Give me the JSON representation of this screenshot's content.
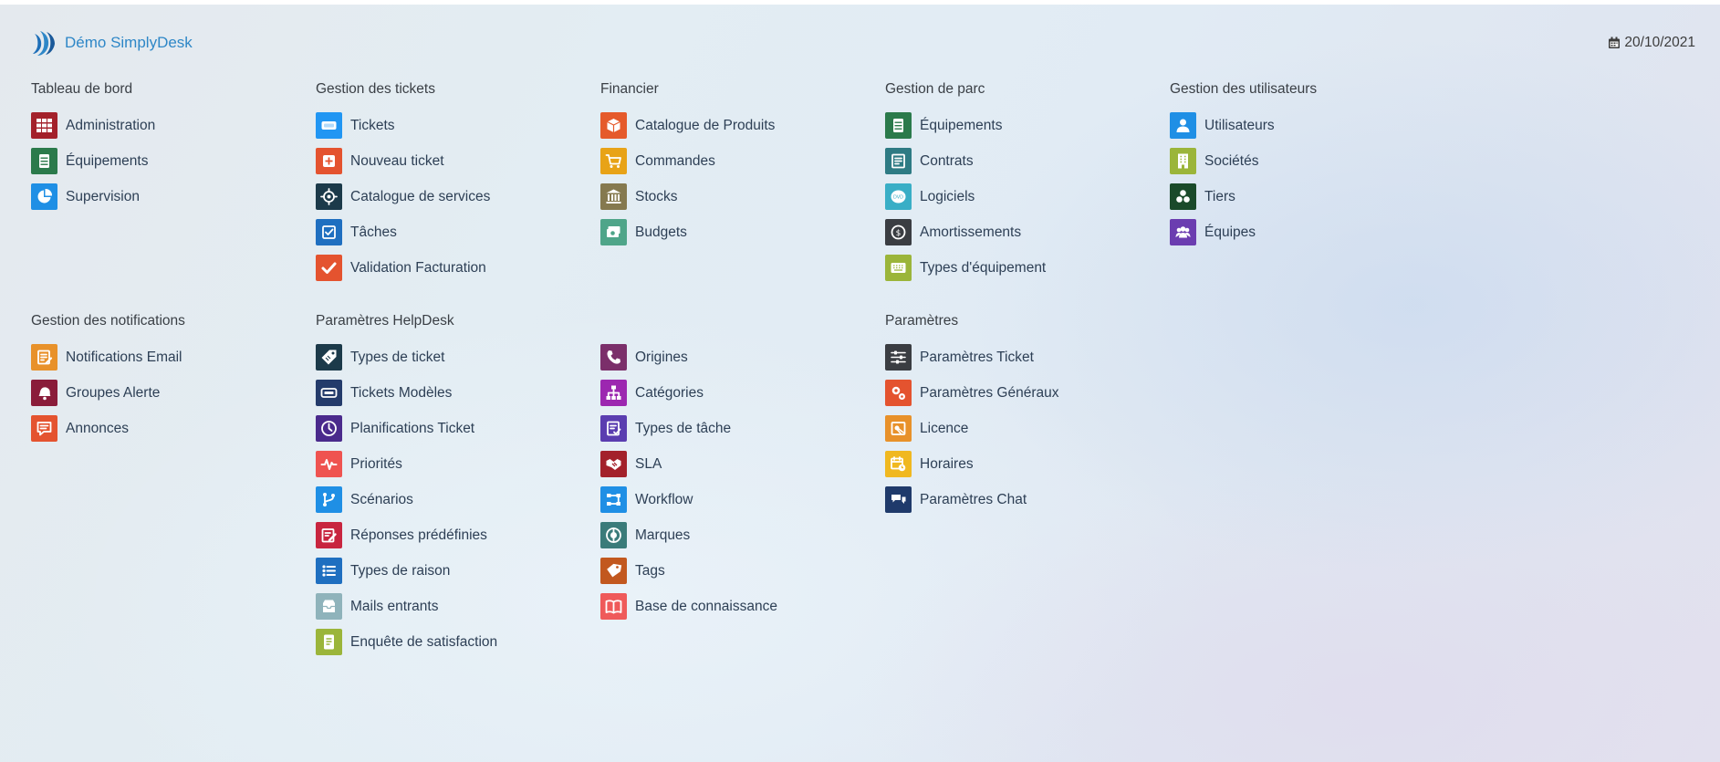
{
  "header": {
    "app_name": "Démo SimplyDesk",
    "date": "20/10/2021"
  },
  "sections": [
    {
      "key": "tableau",
      "title": "Tableau de bord",
      "items": [
        {
          "label": "Administration",
          "icon": "grid-icon",
          "color": "#a3212b"
        },
        {
          "label": "Équipements",
          "icon": "server-icon",
          "color": "#2b7a4b"
        },
        {
          "label": "Supervision",
          "icon": "pie-chart-icon",
          "color": "#1f8fe5"
        }
      ]
    },
    {
      "key": "tickets",
      "title": "Gestion des tickets",
      "items": [
        {
          "label": "Tickets",
          "icon": "ticket-icon",
          "color": "#2196f3"
        },
        {
          "label": "Nouveau ticket",
          "icon": "plus-icon",
          "color": "#e4532f"
        },
        {
          "label": "Catalogue de services",
          "icon": "target-icon",
          "color": "#1c3a4a"
        },
        {
          "label": "Tâches",
          "icon": "checkbox-icon",
          "color": "#1f6fc0"
        },
        {
          "label": "Validation Facturation",
          "icon": "check-icon",
          "color": "#e4532f"
        }
      ]
    },
    {
      "key": "financier",
      "title": "Financier",
      "items": [
        {
          "label": "Catalogue de Produits",
          "icon": "box-icon",
          "color": "#e55a2b"
        },
        {
          "label": "Commandes",
          "icon": "cart-icon",
          "color": "#e8a317"
        },
        {
          "label": "Stocks",
          "icon": "bank-icon",
          "color": "#85794f"
        },
        {
          "label": "Budgets",
          "icon": "money-icon",
          "color": "#4fa589"
        }
      ]
    },
    {
      "key": "parc",
      "title": "Gestion de parc",
      "items": [
        {
          "label": "Équipements",
          "icon": "server-icon",
          "color": "#2b7a4b"
        },
        {
          "label": "Contrats",
          "icon": "contract-icon",
          "color": "#2e7b84"
        },
        {
          "label": "Logiciels",
          "icon": "dvd-icon",
          "color": "#39aec6"
        },
        {
          "label": "Amortissements",
          "icon": "coin-icon",
          "color": "#3a3d42"
        },
        {
          "label": "Types d'équipement",
          "icon": "keyboard-icon",
          "color": "#9bb53a"
        }
      ]
    },
    {
      "key": "utilisateurs",
      "title": "Gestion des utilisateurs",
      "items": [
        {
          "label": "Utilisateurs",
          "icon": "user-icon",
          "color": "#1f8fe5"
        },
        {
          "label": "Sociétés",
          "icon": "building-icon",
          "color": "#9bb53a"
        },
        {
          "label": "Tiers",
          "icon": "cubes-icon",
          "color": "#1a4a2a"
        },
        {
          "label": "Équipes",
          "icon": "team-icon",
          "color": "#6b3db0"
        }
      ]
    },
    {
      "key": "notifications",
      "title": "Gestion des notifications",
      "items": [
        {
          "label": "Notifications Email",
          "icon": "note-icon",
          "color": "#e8912a"
        },
        {
          "label": "Groupes Alerte",
          "icon": "bell-icon",
          "color": "#8a1c3a"
        },
        {
          "label": "Annonces",
          "icon": "message-icon",
          "color": "#e4532f"
        }
      ]
    },
    {
      "key": "helpdesk",
      "title": "Paramètres HelpDesk",
      "items": [
        {
          "label": "Types de ticket",
          "icon": "tag-icon",
          "color": "#1c3a4a"
        },
        {
          "label": "Tickets Modèles",
          "icon": "ticket-template-icon",
          "color": "#243b6b"
        },
        {
          "label": "Planifications Ticket",
          "icon": "clock-icon",
          "color": "#4a2a8c"
        },
        {
          "label": "Priorités",
          "icon": "pulse-icon",
          "color": "#ef5350"
        },
        {
          "label": "Scénarios",
          "icon": "branch-icon",
          "color": "#1f8fe5"
        },
        {
          "label": "Réponses prédéfinies",
          "icon": "edit-icon",
          "color": "#c8253f"
        },
        {
          "label": "Types de raison",
          "icon": "list-icon",
          "color": "#1f6fc0"
        },
        {
          "label": "Mails entrants",
          "icon": "inbox-icon",
          "color": "#8fb3bb"
        },
        {
          "label": "Enquête de satisfaction",
          "icon": "survey-icon",
          "color": "#9bb53a"
        }
      ]
    },
    {
      "key": "helpdesk2",
      "title": "",
      "items": [
        {
          "label": "Origines",
          "icon": "phone-icon",
          "color": "#7b2f6a"
        },
        {
          "label": "Catégories",
          "icon": "hierarchy-icon",
          "color": "#9c27b0"
        },
        {
          "label": "Types de tâche",
          "icon": "task-type-icon",
          "color": "#5a3db0"
        },
        {
          "label": "SLA",
          "icon": "handshake-icon",
          "color": "#a3212b"
        },
        {
          "label": "Workflow",
          "icon": "workflow-icon",
          "color": "#1f8fe5"
        },
        {
          "label": "Marques",
          "icon": "brand-icon",
          "color": "#3a7b7a"
        },
        {
          "label": "Tags",
          "icon": "tags-icon",
          "color": "#c2581f"
        },
        {
          "label": "Base de connaissance",
          "icon": "book-icon",
          "color": "#ef5a5a"
        }
      ]
    },
    {
      "key": "parametres",
      "title": "Paramètres",
      "items": [
        {
          "label": "Paramètres Ticket",
          "icon": "sliders-icon",
          "color": "#3a3d42"
        },
        {
          "label": "Paramètres Généraux",
          "icon": "gears-icon",
          "color": "#e4532f"
        },
        {
          "label": "Licence",
          "icon": "license-icon",
          "color": "#e8912a"
        },
        {
          "label": "Horaires",
          "icon": "calendar-clock-icon",
          "color": "#f0b820"
        },
        {
          "label": "Paramètres Chat",
          "icon": "chat-icon",
          "color": "#1f3a6b"
        }
      ]
    }
  ]
}
